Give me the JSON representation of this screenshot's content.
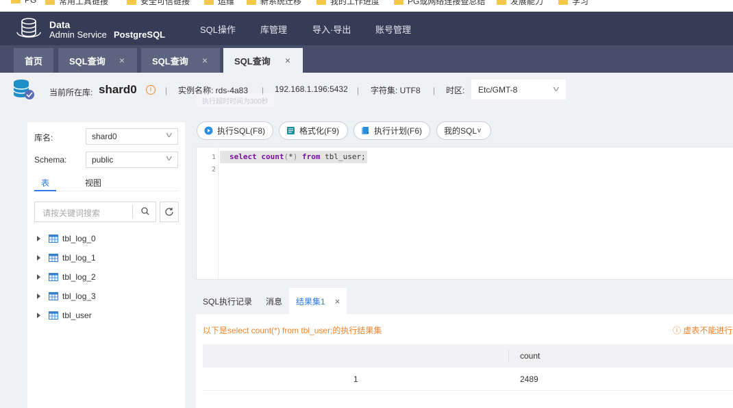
{
  "bookmarks": [
    "PG",
    "常用工具链接",
    "安全可信链接",
    "运维",
    "新系统迁移",
    "我的工作进度",
    "PG或网络连接查总结",
    "发展能力",
    "学习"
  ],
  "brand": {
    "title": "Data",
    "subtitle": "Admin Service",
    "db": "PostgreSQL"
  },
  "nav": {
    "menu": [
      "SQL操作",
      "库管理",
      "导入·导出",
      "账号管理"
    ]
  },
  "page_tabs": [
    {
      "label": "首页",
      "close": ""
    },
    {
      "label": "SQL查询",
      "close": "×"
    },
    {
      "label": "SQL查询",
      "close": "×"
    },
    {
      "label": "SQL查询",
      "close": "×"
    }
  ],
  "info": {
    "current_db_label": "当前所在库:",
    "current_db": "shard0",
    "warn_glyph": "i",
    "instance": "实例名称: rds-4a83",
    "address": "192.168.1.196:5432",
    "charset": "字符集: UTF8",
    "timezone_label": "时区:",
    "timezone": "Etc/GMT-8",
    "tooltip": "执行超时时间为300秒",
    "separator": "|"
  },
  "left": {
    "db_label": "库名:",
    "db_value": "shard0",
    "schema_label": "Schema:",
    "schema_value": "public",
    "tab_tables": "表",
    "tab_views": "视图",
    "search_placeholder": "请按关键词搜索",
    "tables": [
      "tbl_log_0",
      "tbl_log_1",
      "tbl_log_2",
      "tbl_log_3",
      "tbl_user"
    ]
  },
  "toolbar": {
    "execute": "执行SQL(F8)",
    "format": "格式化(F9)",
    "plan": "执行计划(F6)",
    "my_sql": "我的SQL"
  },
  "editor": {
    "line_numbers": [
      "1",
      "2"
    ],
    "code": {
      "kw1": "select",
      "fn": "count",
      "open": "(",
      "star": "*",
      "close": ")",
      "kw2": "from",
      "table": "tbl_user;"
    }
  },
  "result_tabs": {
    "history": "SQL执行记录",
    "messages": "消息",
    "resultset": "结果集1",
    "close": "×"
  },
  "result": {
    "message": "以下是select count(*) from tbl_user;的执行结果集",
    "warning": "ⓘ 虚表不能进行编辑",
    "columns": [
      "count"
    ],
    "rows": [
      {
        "idx": "1",
        "count": "2489"
      }
    ]
  },
  "colors": {
    "nav_bg": "#363c56",
    "accent": "#2a7be4",
    "warn": "#f0832a"
  }
}
